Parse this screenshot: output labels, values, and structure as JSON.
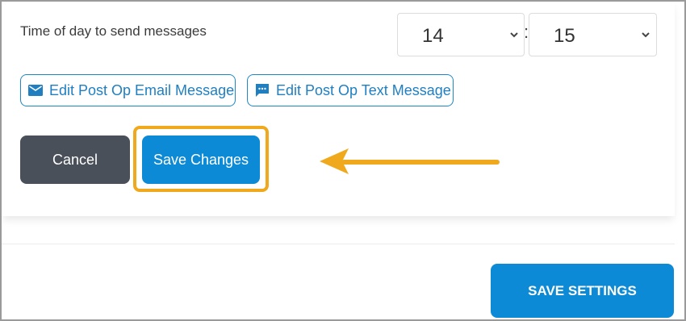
{
  "schedule": {
    "label": "Time of day to send messages",
    "hour": "14",
    "separator": ":",
    "minute": "15"
  },
  "message_buttons": {
    "email_label": "Edit Post Op Email Message",
    "email_icon": "envelope-icon",
    "text_label": "Edit Post Op Text Message",
    "text_icon": "chat-bubble-icon"
  },
  "actions": {
    "cancel_label": "Cancel",
    "save_label": "Save Changes"
  },
  "footer": {
    "save_settings_label": "SAVE SETTINGS"
  },
  "colors": {
    "primary": "#0c8ad6",
    "link": "#1f7fc0",
    "cancel": "#4a5059",
    "highlight": "#f0a81c"
  }
}
